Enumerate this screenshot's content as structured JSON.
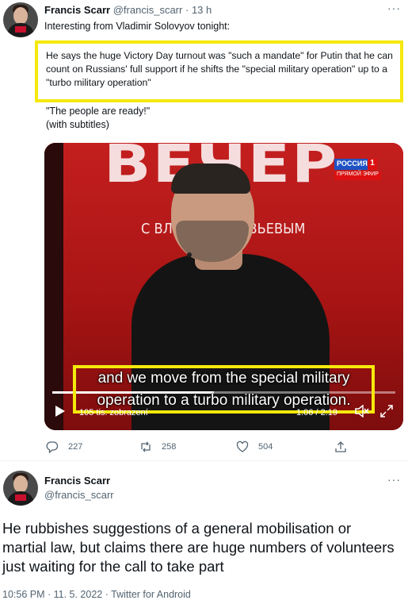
{
  "tweet1": {
    "author_name": "Francis Scarr",
    "author_handle": "@francis_scarr",
    "separator": "·",
    "time": "13 h",
    "more": "···",
    "intro": "Interesting from Vladimir Solovyov tonight:",
    "highlighted_text": "He says the huge Victory Day turnout was \"such a mandate\" for Putin that he can count on Russians' full support if he shifts the \"special military operation\" up to a \"turbo military operation\"",
    "quote_line1": "\"The people are ready!\"",
    "quote_line2": "(with subtitles)",
    "video": {
      "backdrop_title": "ВЕЧЕР",
      "backdrop_subtitle": "С ВЛ          РОМ СОЛОВЬЕВЫМ",
      "channel_logo_top": "РОССИЯ",
      "channel_logo_num": "1",
      "channel_logo_bottom": "ПРЯМОЙ ЭФИР",
      "subtitle_line1": "and we move from the special military",
      "subtitle_line2": "operation to a turbo military operation.",
      "views": "105 tis. zobrazení",
      "time": "1:06 / 2:19",
      "progress": 0.47
    },
    "replies": "227",
    "retweets": "258",
    "likes": "504"
  },
  "tweet2": {
    "author_name": "Francis Scarr",
    "author_handle": "@francis_scarr",
    "more": "···",
    "text": "He rubbishes suggestions of a general mobilisation or martial law, but claims there are huge numbers of volunteers just waiting for the call to take part",
    "meta": "10:56 PM · 11. 5. 2022 · Twitter for Android"
  },
  "colors": {
    "highlight": "#f5e90c",
    "secondary_text": "#536471",
    "video_red": "#c41f1f"
  }
}
